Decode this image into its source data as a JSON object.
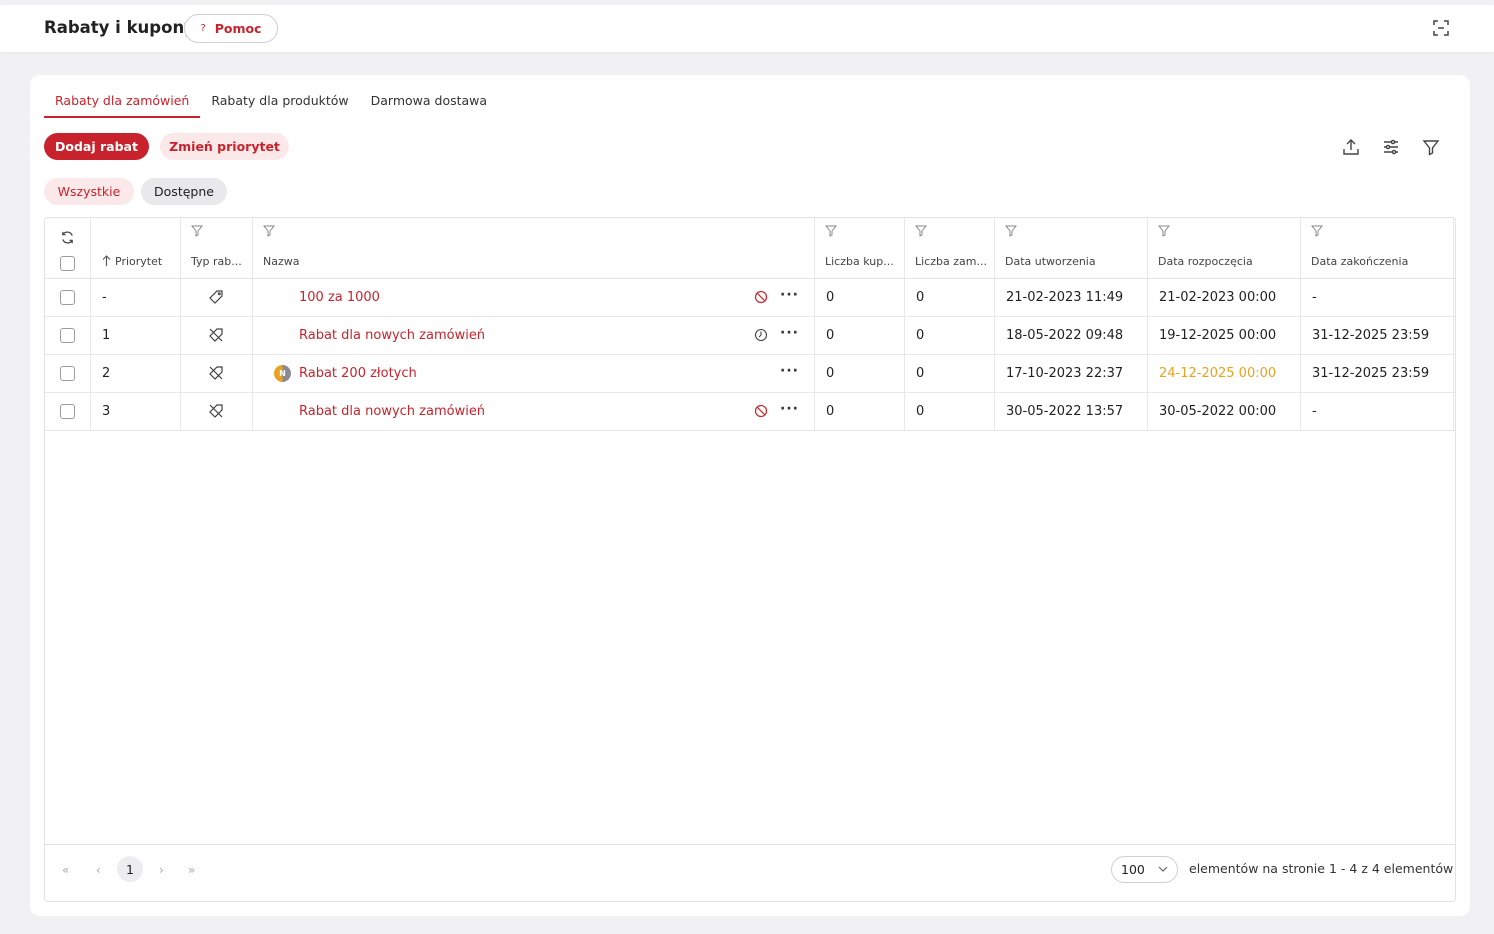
{
  "header": {
    "title": "Rabaty i kupony",
    "help_label": "Pomoc",
    "help_glyph": "?"
  },
  "tabs": [
    {
      "label": "Rabaty dla zamówień",
      "active": true
    },
    {
      "label": "Rabaty dla produktów",
      "active": false
    },
    {
      "label": "Darmowa dostawa",
      "active": false
    }
  ],
  "actions": {
    "add_label": "Dodaj rabat",
    "priority_label": "Zmień priorytet"
  },
  "filters": [
    {
      "label": "Wszystkie",
      "active": true
    },
    {
      "label": "Dostępne",
      "active": false
    }
  ],
  "table": {
    "columns": {
      "priority": "Priorytet",
      "type": "Typ rab...",
      "name": "Nazwa",
      "coupons": "Liczba kup...",
      "orders": "Liczba zam...",
      "created": "Data utworzenia",
      "start": "Data rozpoczęcia",
      "end": "Data zakończenia"
    },
    "sort_indicator": "ascending",
    "rows": [
      {
        "priority": "-",
        "type_icon": "tag-icon",
        "name": "100 za 1000",
        "status_icon": "disabled-icon",
        "coupons": "0",
        "orders": "0",
        "created": "21-02-2023 11:49",
        "start": "21-02-2023 00:00",
        "end": "-",
        "start_highlight": false
      },
      {
        "priority": "1",
        "type_icon": "tag-crossed-icon",
        "name": "Rabat dla nowych zamówień",
        "status_icon": "clock-icon",
        "coupons": "0",
        "orders": "0",
        "created": "18-05-2022 09:48",
        "start": "19-12-2025 00:00",
        "end": "31-12-2025 23:59",
        "start_highlight": false
      },
      {
        "priority": "2",
        "type_icon": "tag-crossed-icon",
        "name": "Rabat 200 złotych",
        "badge": "N",
        "status_icon": "",
        "coupons": "0",
        "orders": "0",
        "created": "17-10-2023 22:37",
        "start": "24-12-2025 00:00",
        "end": "31-12-2025 23:59",
        "start_highlight": true
      },
      {
        "priority": "3",
        "type_icon": "tag-crossed-icon",
        "name": "Rabat dla nowych zamówień",
        "status_icon": "disabled-icon",
        "coupons": "0",
        "orders": "0",
        "created": "30-05-2022 13:57",
        "start": "30-05-2022 00:00",
        "end": "-",
        "start_highlight": false
      }
    ],
    "more_glyph": "···"
  },
  "pagination": {
    "first": "«",
    "prev": "‹",
    "current": "1",
    "next": "›",
    "last": "»",
    "page_size": "100",
    "per_page_label": "elementów na stronie",
    "range_label": "1 - 4 z 4 elementów"
  },
  "colors": {
    "accent": "#c8232d",
    "accent_soft": "#fbe9ea",
    "warning": "#e8a220"
  }
}
